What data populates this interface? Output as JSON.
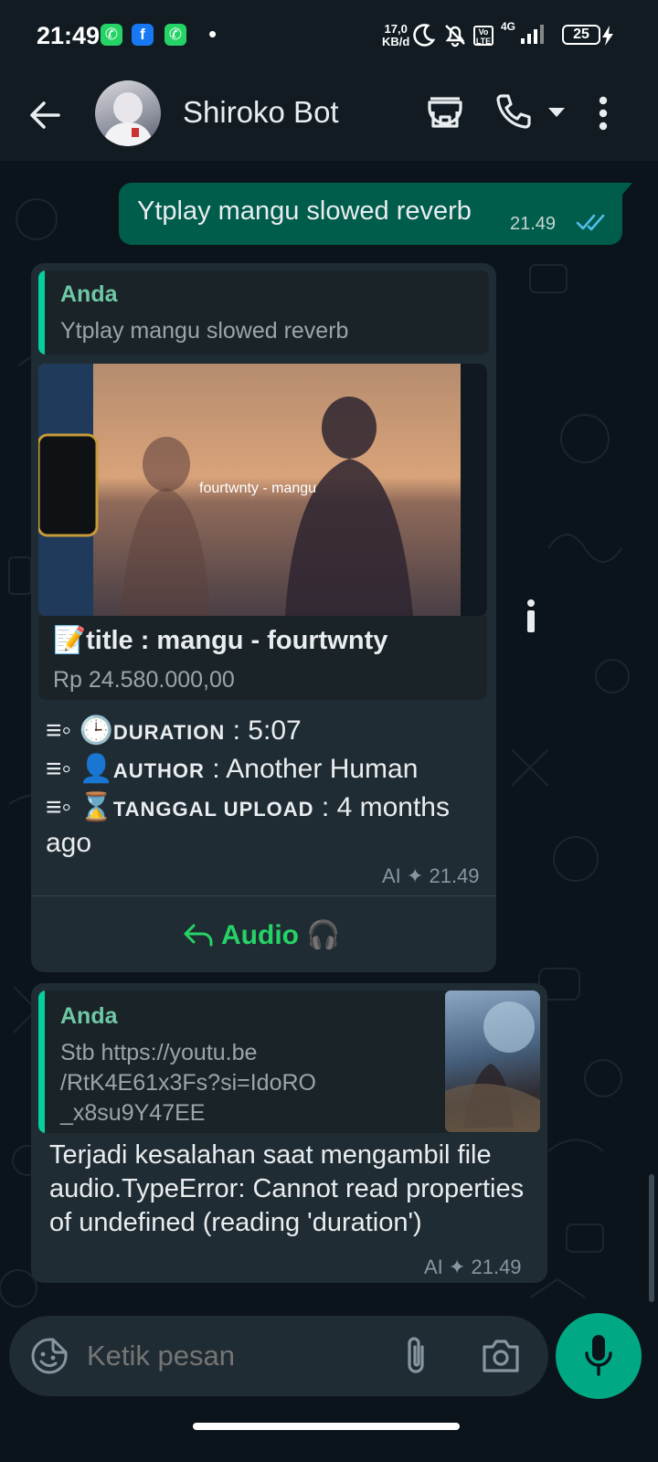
{
  "status_bar": {
    "time": "21:49",
    "apps": [
      "whatsapp-icon",
      "facebook-icon",
      "whatsapp-icon"
    ],
    "speed_value": "17,0",
    "speed_unit": "KB/d",
    "network": "4G",
    "volte": "Vo LTE",
    "battery": "25"
  },
  "header": {
    "contact_name": "Shiroko Bot",
    "icons": [
      "back-arrow-icon",
      "store-icon",
      "phone-icon",
      "dropdown-icon",
      "more-icon"
    ]
  },
  "messages": {
    "outgoing": {
      "text": "Ytplay mangu slowed reverb",
      "time": "21.49",
      "status": "read"
    },
    "bot_reply_1": {
      "quote_name": "Anda",
      "quote_text": "Ytplay mangu slowed reverb",
      "video_overlay": "fourtwnty - mangu",
      "link_title": "📝title : mangu - fourtwnty",
      "link_price": "Rp 24.580.000,00",
      "line1_prefix": "≡◦ 🕒",
      "line1_label": "DURATION",
      "line1_value": " : 5:07",
      "line2_prefix": "≡◦ 👤",
      "line2_label": "AUTHOR",
      "line2_value": " : Another Human",
      "line3_prefix": "≡◦ ⌛",
      "line3_label": "TANGGAL UPLOAD",
      "line3_value": " : 4 months",
      "line4": "ago",
      "meta_ai": "AI",
      "time": "21.49",
      "button_label": "Audio 🎧"
    },
    "bot_reply_2": {
      "quote_name": "Anda",
      "quote_line1": "Stb https://youtu.be",
      "quote_line2": "/RtK4E61x3Fs?si=IdoRO",
      "quote_line3": "_x8su9Y47EE",
      "text": "Terjadi kesalahan saat mengambil file audio.TypeError: Cannot read properties of undefined (reading 'duration')",
      "meta_ai": "AI",
      "time": "21.49"
    }
  },
  "composer": {
    "placeholder": "Ketik pesan"
  },
  "colors": {
    "background": "#0b141a",
    "header": "#111b21",
    "outgoing_bubble": "#005c4b",
    "incoming_bubble": "#202c33",
    "accent": "#00a884",
    "link_green": "#25d366",
    "read_tick": "#53bdeb"
  }
}
